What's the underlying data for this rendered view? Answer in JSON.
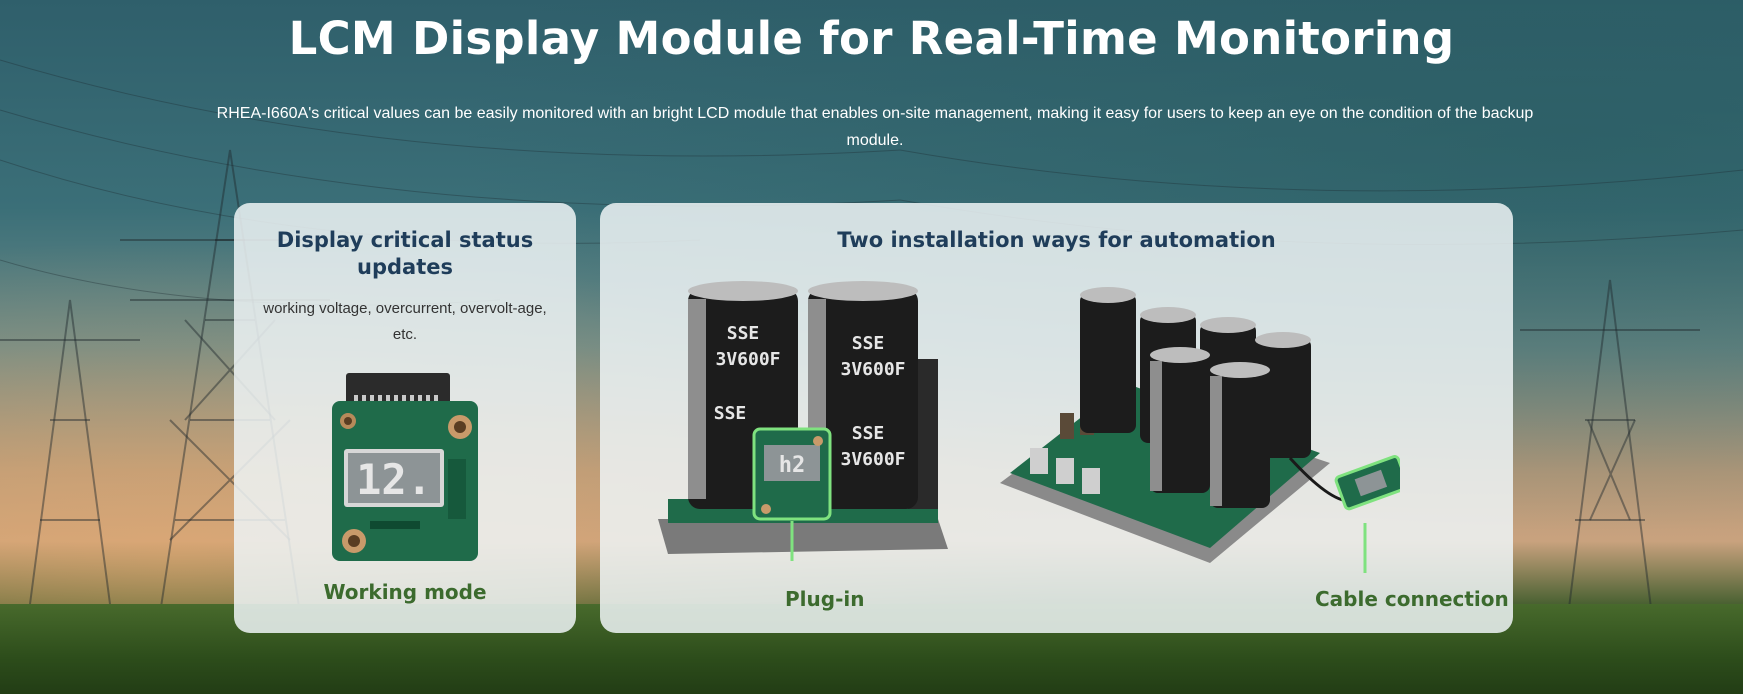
{
  "hero": {
    "title": "LCM Display Module for Real-Time Monitoring",
    "description": "RHEA-I660A's critical values can be easily monitored with an bright LCD module that enables on-site management, making it easy for users to keep an eye on the condition of the backup module."
  },
  "left_card": {
    "title": "Display critical status updates",
    "subtitle": "working voltage, overcurrent, overvolt-age, etc.",
    "lcd_digits": "12.",
    "label": "Working mode"
  },
  "right_card": {
    "title": "Two installation ways for automation",
    "capacitor_brand": "SSE",
    "capacitor_rating": "3V600F",
    "lcd_digits_small": "h2",
    "plugin_label": "Plug-in",
    "cable_label": "Cable connection"
  },
  "colors": {
    "title_blue": "#1f3d5a",
    "label_green": "#3c6b2e",
    "pcb_green": "#1f6b4a"
  }
}
